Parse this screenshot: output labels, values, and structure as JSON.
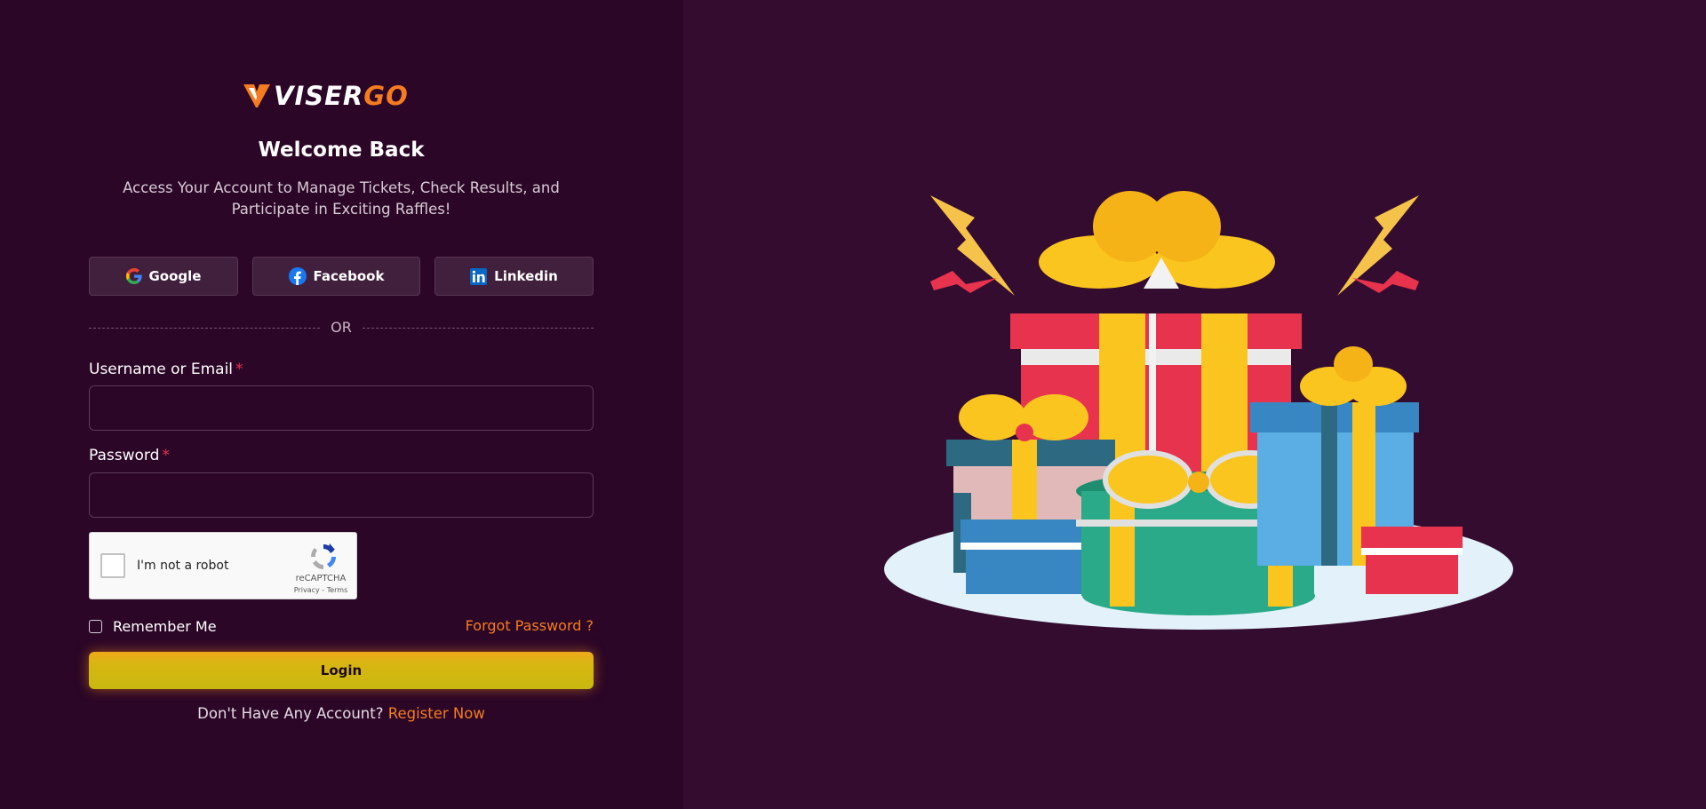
{
  "brand": {
    "name_part1": "VISER",
    "name_part2": "GO",
    "accent_color": "#f47c20"
  },
  "header": {
    "title": "Welcome Back",
    "subtitle": "Access Your Account to Manage Tickets, Check Results, and Participate in Exciting Raffles!"
  },
  "social": {
    "google_label": "Google",
    "facebook_label": "Facebook",
    "linkedin_label": "Linkedin"
  },
  "divider": {
    "text": "OR"
  },
  "form": {
    "username_label": "Username or Email",
    "username_value": "",
    "password_label": "Password",
    "password_value": "",
    "required_mark": "*"
  },
  "captcha": {
    "label": "I'm not a robot",
    "brand": "reCAPTCHA",
    "links": "Privacy - Terms"
  },
  "options": {
    "remember_label": "Remember Me",
    "forgot_label": "Forgot Password ?"
  },
  "actions": {
    "login_label": "Login",
    "register_prompt": "Don't Have Any Account?",
    "register_link": "Register Now"
  },
  "illustration": {
    "icon": "gift-boxes-illustration"
  }
}
